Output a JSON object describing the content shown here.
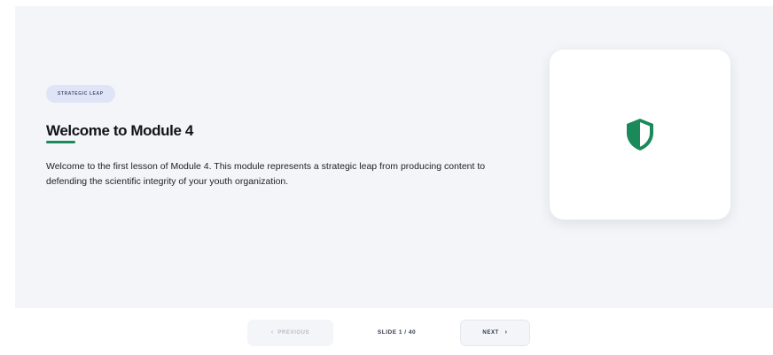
{
  "slide": {
    "tag": "STRATEGIC LEAP",
    "title": "Welcome to Module 4",
    "body": "Welcome to the first lesson of Module 4. This module represents a strategic leap from producing content to defending the scientific integrity of your youth organization.",
    "icon": "shield-icon",
    "accent_color": "#1b8a5a"
  },
  "navigation": {
    "previous_label": "PREVIOUS",
    "previous_chevron": "‹",
    "next_label": "NEXT",
    "next_chevron": "›",
    "counter": "SLIDE 1 / 40"
  }
}
